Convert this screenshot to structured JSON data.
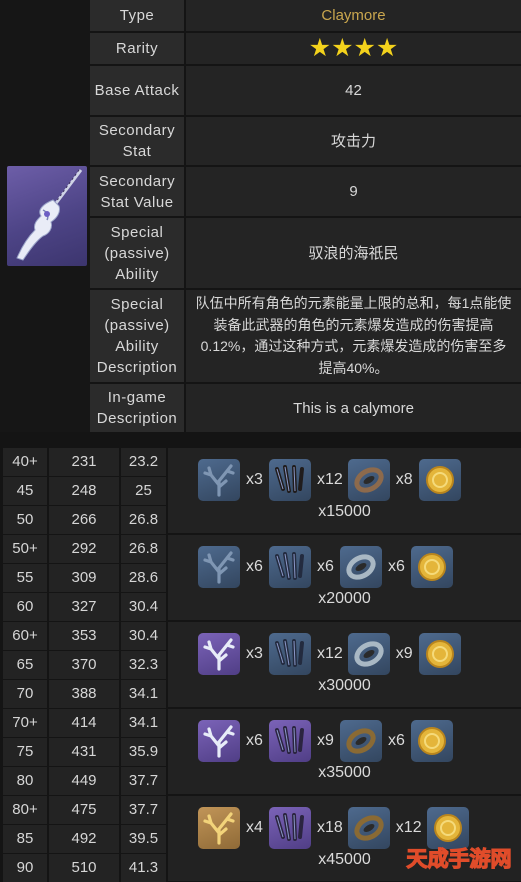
{
  "info": {
    "rows": [
      {
        "label": "Type",
        "value": "Claymore"
      },
      {
        "label": "Rarity",
        "value": "★★★★"
      },
      {
        "label": "Base Attack",
        "value": "42"
      },
      {
        "label": "Secondary Stat",
        "value": "攻击力"
      },
      {
        "label": "Secondary Stat Value",
        "value": "9"
      },
      {
        "label": "Special (passive) Ability",
        "value": "驭浪的海祇民"
      },
      {
        "label": "Special (passive) Ability Description",
        "value": "队伍中所有角色的元素能量上限的总和，每1点能使装备此武器的角色的元素爆发造成的伤害提高0.12%，通过这种方式，元素爆发造成的伤害至多提高40%。"
      },
      {
        "label": "In-game Description",
        "value": "This is a calymore"
      }
    ],
    "weapon_icon": "claymore-weapon-icon"
  },
  "ascension": {
    "levels": [
      [
        "40+",
        "231",
        "23.2"
      ],
      [
        "45",
        "248",
        "25"
      ],
      [
        "50",
        "266",
        "26.8"
      ],
      [
        "50+",
        "292",
        "26.8"
      ],
      [
        "55",
        "309",
        "28.6"
      ],
      [
        "60",
        "327",
        "30.4"
      ],
      [
        "60+",
        "353",
        "30.4"
      ],
      [
        "65",
        "370",
        "32.3"
      ],
      [
        "70",
        "388",
        "34.1"
      ],
      [
        "70+",
        "414",
        "34.1"
      ],
      [
        "75",
        "431",
        "35.9"
      ],
      [
        "80",
        "449",
        "37.7"
      ],
      [
        "80+",
        "475",
        "37.7"
      ],
      [
        "85",
        "492",
        "39.5"
      ],
      [
        "90",
        "510",
        "41.3"
      ]
    ],
    "materials": [
      {
        "items": [
          {
            "icon": "blue-coral-icon",
            "qty": "x3"
          },
          {
            "icon": "black-claw-icon",
            "qty": "x12"
          },
          {
            "icon": "brown-ring-icon",
            "qty": "x8"
          },
          {
            "icon": "mora-coin-icon",
            "qty": ""
          }
        ],
        "mora": "x15000"
      },
      {
        "items": [
          {
            "icon": "blue-coral-icon",
            "qty": "x6"
          },
          {
            "icon": "blue-claw-icon",
            "qty": "x6"
          },
          {
            "icon": "silver-ring-icon",
            "qty": "x6"
          },
          {
            "icon": "mora-coin-icon",
            "qty": ""
          }
        ],
        "mora": "x20000"
      },
      {
        "items": [
          {
            "icon": "purple-coral-icon",
            "qty": "x3"
          },
          {
            "icon": "blue-claw-icon",
            "qty": "x12"
          },
          {
            "icon": "silver-ring-icon",
            "qty": "x9"
          },
          {
            "icon": "mora-coin-icon",
            "qty": ""
          }
        ],
        "mora": "x30000"
      },
      {
        "items": [
          {
            "icon": "purple-coral-icon",
            "qty": "x6"
          },
          {
            "icon": "purple-claw-icon",
            "qty": "x9"
          },
          {
            "icon": "gold-ring-icon",
            "qty": "x6"
          },
          {
            "icon": "mora-coin-icon",
            "qty": ""
          }
        ],
        "mora": "x35000"
      },
      {
        "items": [
          {
            "icon": "gold-coral-icon",
            "qty": "x4"
          },
          {
            "icon": "purple-claw-icon",
            "qty": "x18"
          },
          {
            "icon": "gold-ring-icon",
            "qty": "x12"
          },
          {
            "icon": "mora-coin-icon",
            "qty": ""
          }
        ],
        "mora": "x45000"
      }
    ]
  },
  "watermark": {
    "text": "天成手游网"
  },
  "colors": {
    "type_value": "#c9a64e",
    "stars": "#f3d21c",
    "label_bg": "#2b2b2b",
    "value_bg": "#242424"
  }
}
